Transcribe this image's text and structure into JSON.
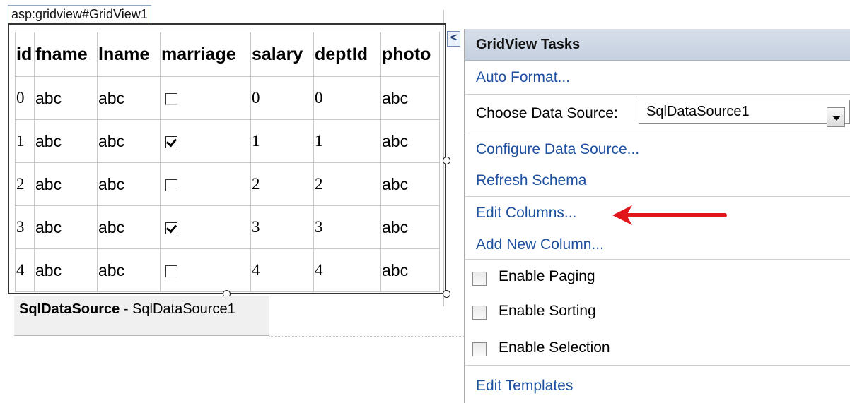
{
  "designer": {
    "tag_label": "asp:gridview#GridView1",
    "smart_tag_glyph": "<",
    "datasource_control": {
      "type_name": "SqlDataSource",
      "separator": " - ",
      "id": "SqlDataSource1"
    }
  },
  "grid": {
    "columns": [
      "id",
      "fname",
      "lname",
      "marriage",
      "salary",
      "deptId",
      "photo"
    ],
    "rows": [
      {
        "id": "0",
        "fname": "abc",
        "lname": "abc",
        "marriage": false,
        "salary": "0",
        "deptId": "0",
        "photo": "abc"
      },
      {
        "id": "1",
        "fname": "abc",
        "lname": "abc",
        "marriage": true,
        "salary": "1",
        "deptId": "1",
        "photo": "abc"
      },
      {
        "id": "2",
        "fname": "abc",
        "lname": "abc",
        "marriage": false,
        "salary": "2",
        "deptId": "2",
        "photo": "abc"
      },
      {
        "id": "3",
        "fname": "abc",
        "lname": "abc",
        "marriage": true,
        "salary": "3",
        "deptId": "3",
        "photo": "abc"
      },
      {
        "id": "4",
        "fname": "abc",
        "lname": "abc",
        "marriage": false,
        "salary": "4",
        "deptId": "4",
        "photo": "abc"
      }
    ]
  },
  "tasks_panel": {
    "title": "GridView Tasks",
    "auto_format": "Auto Format...",
    "choose_data_source_label": "Choose Data Source:",
    "data_source_value": "SqlDataSource1",
    "configure_data_source": "Configure Data Source...",
    "refresh_schema": "Refresh Schema",
    "edit_columns": "Edit Columns...",
    "add_new_column": "Add New Column...",
    "enable_paging": "Enable Paging",
    "enable_sorting": "Enable Sorting",
    "enable_selection": "Enable Selection",
    "edit_templates": "Edit Templates"
  },
  "annotation": {
    "arrow_color": "#e0161b",
    "points_to": "edit_columns"
  }
}
